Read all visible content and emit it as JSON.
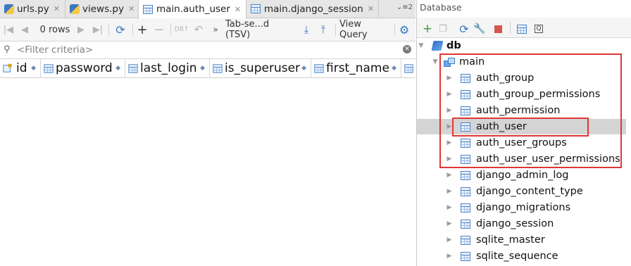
{
  "editor_tabs": [
    {
      "label": "urls.py",
      "icon": "python-file-icon",
      "active": false
    },
    {
      "label": "views.py",
      "icon": "python-file-icon",
      "active": false
    },
    {
      "label": "main.auth_user",
      "icon": "table-icon",
      "active": true
    },
    {
      "label": "main.django_session",
      "icon": "table-icon",
      "active": false
    }
  ],
  "tabs_overflow": "⌄≡2",
  "toolbar": {
    "rows_label": "0 rows",
    "export_format": "Tab-se...d (TSV)",
    "view_query_label": "View Query"
  },
  "filter": {
    "placeholder": "<Filter criteria>"
  },
  "columns": [
    {
      "name": "id",
      "icon": "primary-key-icon"
    },
    {
      "name": "password",
      "icon": "column-icon"
    },
    {
      "name": "last_login",
      "icon": "column-icon"
    },
    {
      "name": "is_superuser",
      "icon": "column-icon"
    },
    {
      "name": "first_name",
      "icon": "column-icon"
    }
  ],
  "database_panel": {
    "title": "Database",
    "data_source": "db",
    "schema": "main",
    "tables": [
      "auth_group",
      "auth_group_permissions",
      "auth_permission",
      "auth_user",
      "auth_user_groups",
      "auth_user_user_permissions",
      "django_admin_log",
      "django_content_type",
      "django_migrations",
      "django_session",
      "sqlite_master",
      "sqlite_sequence"
    ],
    "selected_table": "auth_user"
  },
  "colors": {
    "highlight_box": "#e03636",
    "selection_bg": "#d4d4d4",
    "accent_blue": "#4c84c6"
  }
}
